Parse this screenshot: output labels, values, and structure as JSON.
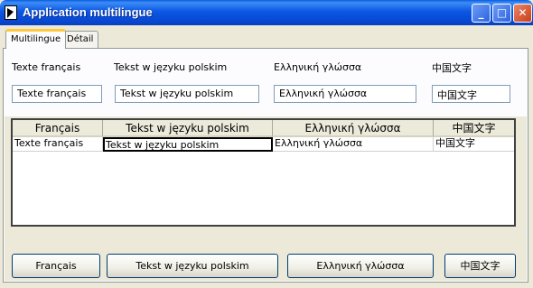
{
  "window": {
    "title": "Application multilingue"
  },
  "tabs": [
    {
      "label": "Multilingue"
    },
    {
      "label": "Détail"
    }
  ],
  "labels": {
    "fr": "Texte français",
    "pl": "Tekst w języku polskim",
    "el": "Ελληνική γλώσσα",
    "zh": "中国文字"
  },
  "fields": {
    "fr": "Texte français",
    "pl": "Tekst w języku polskim",
    "el": "Ελληνική γλώσσα",
    "zh": "中国文字"
  },
  "table": {
    "columns": [
      "Français",
      "Tekst w języku polskim",
      "Ελληνική γλώσσα",
      "中国文字"
    ],
    "rows": [
      [
        "Texte français",
        "Tekst w języku polskim",
        "Ελληνική γλώσσα",
        "中国文字"
      ]
    ]
  },
  "buttons": {
    "fr": "Français",
    "pl": "Tekst w języku polskim",
    "el": "Ελληνική γλώσσα",
    "zh": "中国文字"
  },
  "colors": {
    "titlebar": "#0a5ee0",
    "tab_highlight": "#ffc83c",
    "window_bg": "#ece9d8"
  },
  "icons": [
    "app-icon",
    "minimize-icon",
    "maximize-icon",
    "close-icon"
  ]
}
